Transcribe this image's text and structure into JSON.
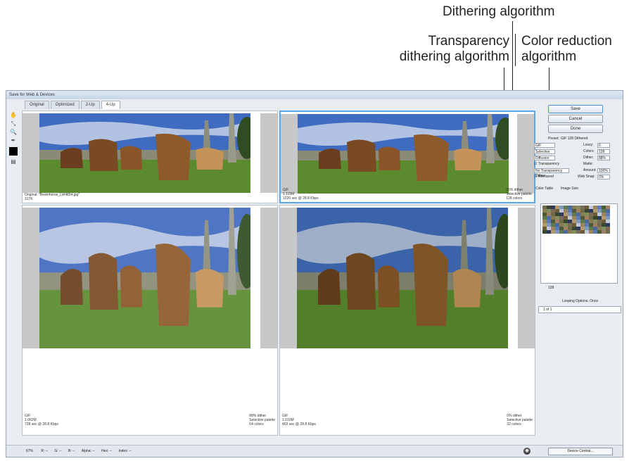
{
  "callouts": {
    "dithering": "Dithering algorithm",
    "transparency_line1": "Transparency",
    "transparency_line2": "dithering algorithm",
    "color_reduction_line1": "Color reduction",
    "color_reduction_line2": "algorithm"
  },
  "window": {
    "title": "Save for Web & Devices",
    "tabs": [
      "Original",
      "Optimized",
      "2-Up",
      "4-Up"
    ],
    "active_tab": "4-Up"
  },
  "panes": [
    {
      "left": "Original: \"Beamhorse_LW4854.jpg\"",
      "left2": "317K",
      "right1": "",
      "right2": "",
      "right3": ""
    },
    {
      "left": "GIF",
      "left2": "1.115M",
      "left3": "1220 sec @ 28.8 Kbps",
      "right1": "85% dither",
      "right2": "Selective palette",
      "right3": "128 colors"
    },
    {
      "left": "GIF",
      "left2": "1.062M",
      "left3": "728 sec @ 28.8 Kbps",
      "right1": "88% dither",
      "right2": "Selective palette",
      "right3": "64 colors"
    },
    {
      "left": "GIF",
      "left2": "1.010M",
      "left3": "403 sec @ 28.8 Kbps",
      "right1": "0% dither",
      "right2": "Selective palette",
      "right3": "32 colors"
    }
  ],
  "right_panel": {
    "save": "Save",
    "cancel": "Cancel",
    "done": "Done",
    "preset_label": "Preset:",
    "preset_value": "GIF 128 Dithered",
    "format": "GIF",
    "reduction": "Selective",
    "dither_algo": "Diffusion",
    "transparency_label": "Transparency",
    "transparency_dither": "No Transparency Dither",
    "interlaced": "Interlaced",
    "lossy_label": "Lossy:",
    "lossy_value": "0",
    "colors_label": "Colors:",
    "colors_value": "128",
    "dither_label": "Dither:",
    "dither_value": "88%",
    "matte_label": "Matte:",
    "amount_label": "Amount:",
    "amount_value": "100%",
    "websnap_label": "Web Snap:",
    "websnap_value": "0%",
    "color_table_tab": "Color Table",
    "image_size_tab": "Image Size",
    "color_count": "128",
    "looping_label": "Looping Options:",
    "looping_value": "Once",
    "frame_counter": "1 of 1"
  },
  "bottom_bar": {
    "zoom": "67%",
    "r": "R: --",
    "g": "G: --",
    "b": "B: --",
    "alpha": "Alpha: --",
    "hex": "Hex: --",
    "index": "Index: --",
    "device_central": "Device Central..."
  },
  "palette_colors": [
    "#6f6a4a",
    "#8a7b50",
    "#4d5a38",
    "#5f7a4a",
    "#9c8558",
    "#b79a6c",
    "#6c5c3a",
    "#3a4730",
    "#7f8f60",
    "#a08060",
    "#4a6aa0",
    "#5a7ab8",
    "#8098c0",
    "#c0c8d8",
    "#2c3b5a",
    "#7a6a58"
  ]
}
